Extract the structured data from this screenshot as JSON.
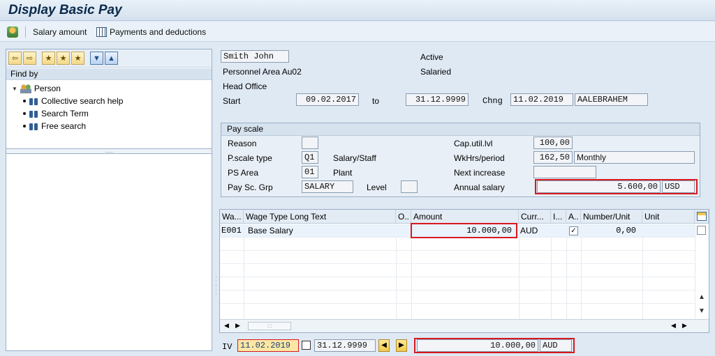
{
  "window": {
    "title": "Display Basic Pay"
  },
  "toolbar": {
    "salary_amount": "Salary amount",
    "payments_deductions": "Payments and deductions"
  },
  "nav": {
    "find_by": "Find by",
    "root": "Person",
    "items": [
      "Collective search help",
      "Search Term",
      "Free search"
    ]
  },
  "header": {
    "name": "Smith John",
    "status1": "Active",
    "personnel_area": "Personnel Area Au02",
    "status2": "Salaried",
    "org": "Head Office",
    "start_label": "Start",
    "start": "09.02.2017",
    "to_label": "to",
    "end": "31.12.9999",
    "chng_label": "Chng",
    "chng_date": "11.02.2019",
    "chng_user": "AALEBRAHEM"
  },
  "payscale": {
    "title": "Pay scale",
    "reason_label": "Reason",
    "reason": "",
    "type_label": "P.scale type",
    "type_code": "Q1",
    "type_text": "Salary/Staff",
    "area_label": "PS Area",
    "area_code": "01",
    "area_text": "Plant",
    "group_label": "Pay Sc. Grp",
    "group": "SALARY",
    "level_label": "Level",
    "level": "",
    "caputil_label": "Cap.util.lvl",
    "caputil": "100,00",
    "wkhrs_label": "WkHrs/period",
    "wkhrs": "162,50",
    "wkhrs_unit": "Monthly",
    "next_label": "Next increase",
    "next": "",
    "annual_label": "Annual salary",
    "annual": "5.600,00",
    "annual_curr": "USD"
  },
  "grid": {
    "columns": [
      "Wa...",
      "Wage Type Long Text",
      "O..",
      "Amount",
      "Curr...",
      "I...",
      "A..",
      "Number/Unit",
      "Unit"
    ],
    "rows": [
      {
        "wagetype": "E001",
        "text": "Base Salary",
        "amount": "10.000,00",
        "curr": "AUD",
        "number": "0,00"
      }
    ]
  },
  "footer": {
    "iv_label": "IV",
    "date_from": "11.02.2019",
    "date_to": "31.12.9999",
    "total": "10.000,00",
    "total_curr": "AUD"
  }
}
